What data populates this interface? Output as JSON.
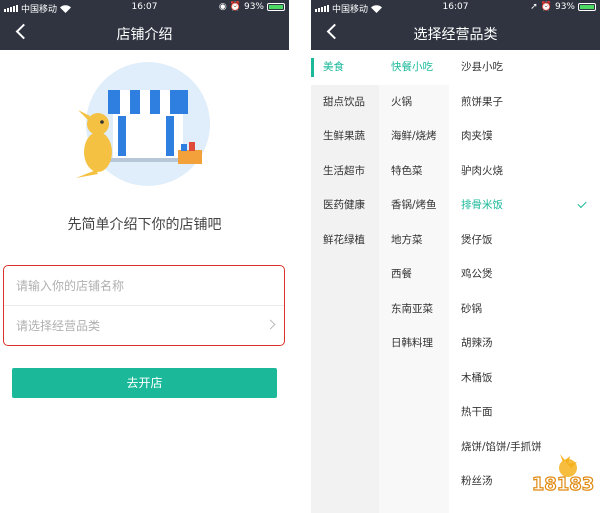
{
  "status_bar": {
    "carrier": "中国移动",
    "time": "16:07",
    "battery": "93%",
    "battery_level": 0.93
  },
  "left": {
    "title": "店铺介绍",
    "prompt": "先简单介绍下你的店铺吧",
    "name_placeholder": "请输入你的店铺名称",
    "category_placeholder": "请选择经营品类",
    "submit_label": "去开店"
  },
  "right": {
    "title": "选择经营品类",
    "main_categories": [
      "美食",
      "甜点饮品",
      "生鲜果蔬",
      "生活超市",
      "医药健康",
      "鲜花绿植"
    ],
    "sub_categories": [
      "快餐小吃",
      "火锅",
      "海鲜/烧烤",
      "特色菜",
      "香锅/烤鱼",
      "地方菜",
      "西餐",
      "东南亚菜",
      "日韩料理"
    ],
    "items": [
      "沙县小吃",
      "煎饼果子",
      "肉夹馍",
      "驴肉火烧",
      "排骨米饭",
      "煲仔饭",
      "鸡公煲",
      "砂锅",
      "胡辣汤",
      "木桶饭",
      "热干面",
      "烧饼/馅饼/手抓饼",
      "粉丝汤"
    ],
    "selected_item": "排骨米饭"
  },
  "watermark": {
    "text": "18183"
  },
  "colors": {
    "accent": "#1bb99a",
    "nav_bg": "#2f3440",
    "highlight_border": "#d9342b"
  }
}
